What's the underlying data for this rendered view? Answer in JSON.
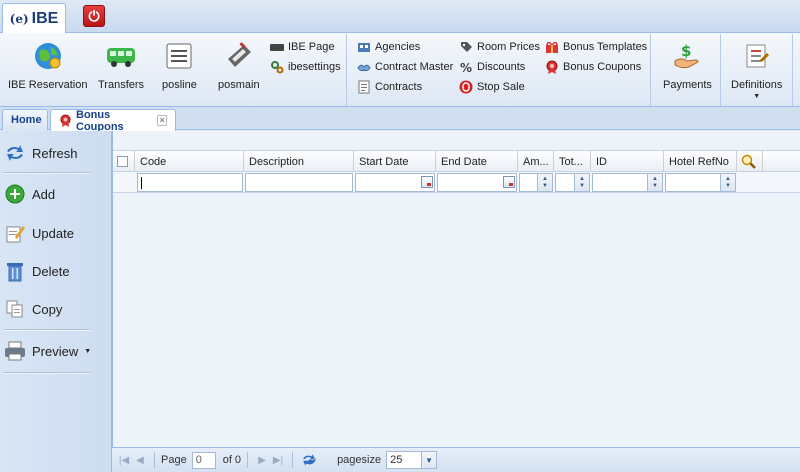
{
  "app": {
    "logo_mark": "(e)",
    "logo_text": "IBE"
  },
  "ribbon": {
    "ibe_reservation": "IBE Reservation",
    "transfers": "Transfers",
    "posline": "posline",
    "posmain": "posmain",
    "ibe_page": "IBE Page",
    "ibesettings": "ibesettings",
    "agencies": "Agencies",
    "contract_master": "Contract Master",
    "contracts": "Contracts",
    "room_prices": "Room Prices",
    "discounts": "Discounts",
    "stop_sale": "Stop Sale",
    "bonus_templates": "Bonus Templates",
    "bonus_coupons": "Bonus Coupons",
    "payments": "Payments",
    "definitions": "Definitions"
  },
  "tabs": {
    "home": "Home",
    "bonus_coupons": "Bonus Coupons"
  },
  "actions": {
    "refresh": "Refresh",
    "add": "Add",
    "update": "Update",
    "delete": "Delete",
    "copy": "Copy",
    "preview": "Preview"
  },
  "grid": {
    "columns": [
      "Code",
      "Description",
      "Start Date",
      "End Date",
      "Am...",
      "Tot...",
      "ID",
      "Hotel RefNo"
    ],
    "rows": []
  },
  "pager": {
    "page_label": "Page",
    "page_value": "0",
    "of_label": "of 0",
    "pagesize_label": "pagesize",
    "pagesize_value": "25"
  },
  "colors": {
    "accent": "#15428b",
    "panel_bg": "#dfe8f6",
    "border": "#99bbe8"
  }
}
